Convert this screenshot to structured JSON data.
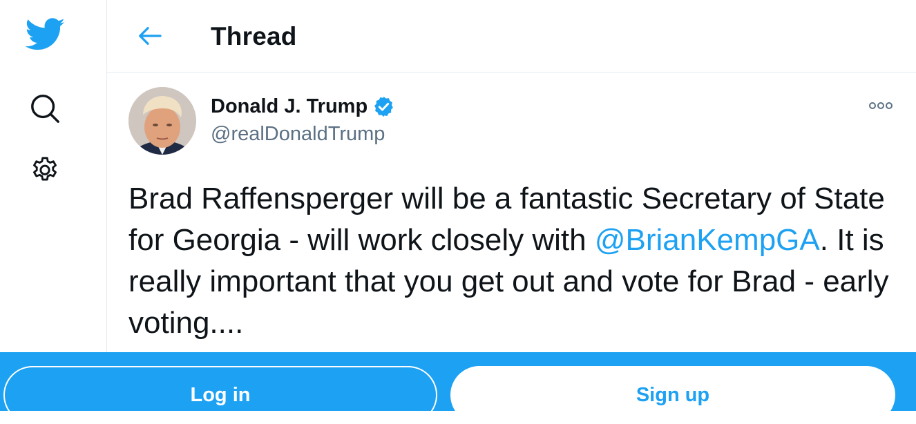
{
  "colors": {
    "accent": "#1da1f2",
    "text_primary": "#0f1419",
    "text_secondary": "#5b7083",
    "divider": "#e6ecf0",
    "bottom_bar": "#1da1f2"
  },
  "sidebar": {
    "logo_icon": "twitter-bird-icon",
    "items": [
      {
        "icon": "search-icon"
      },
      {
        "icon": "gear-icon"
      }
    ]
  },
  "header": {
    "back_icon": "arrow-left-icon",
    "title": "Thread"
  },
  "tweet": {
    "author_name": "Donald J. Trump",
    "verified_icon": "verified-badge-icon",
    "handle": "@realDonaldTrump",
    "more_icon": "more-horizontal-icon",
    "text_before": "Brad Raffensperger will be a fantastic Secretary of State for Georgia - will work closely with ",
    "mention": "@BrianKempGA",
    "text_after": ". It is really important that you get out and vote for Brad - early voting...."
  },
  "bottom_bar": {
    "login_label": "Log in",
    "signup_label": "Sign up"
  }
}
